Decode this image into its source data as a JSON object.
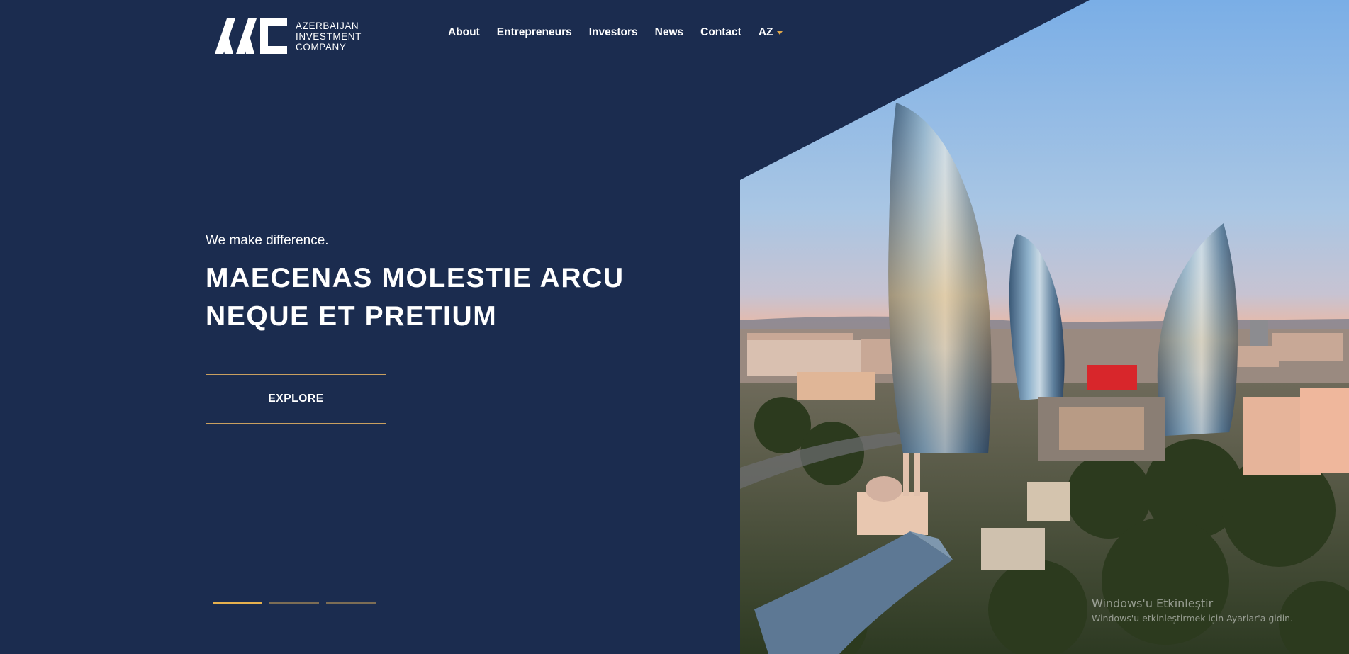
{
  "brand": {
    "logo_mark": "AIC",
    "name_lines": [
      "AZERBAIJAN",
      "INVESTMENT",
      "COMPANY"
    ]
  },
  "nav": {
    "items": [
      "About",
      "Entrepreneurs",
      "Investors",
      "News",
      "Contact"
    ],
    "language": "AZ",
    "language_icon": "chevron-down-icon"
  },
  "hero": {
    "tagline": "We make difference.",
    "headline_lines": [
      "MAECENAS MOLESTIE ARCU",
      "NEQUE ET PRETIUM"
    ],
    "cta_label": "EXPLORE",
    "image_subject": "Baku Flame Towers skyline at sunset"
  },
  "slider": {
    "count": 3,
    "active_index": 0
  },
  "watermark": {
    "title": "Windows'u Etkinleştir",
    "subtitle": "Windows'u etkinleştirmek için Ayarlar'a gidin."
  },
  "colors": {
    "background": "#1b2c4f",
    "accent": "#e6b14e",
    "button_border": "#c9a060",
    "text": "#ffffff"
  }
}
